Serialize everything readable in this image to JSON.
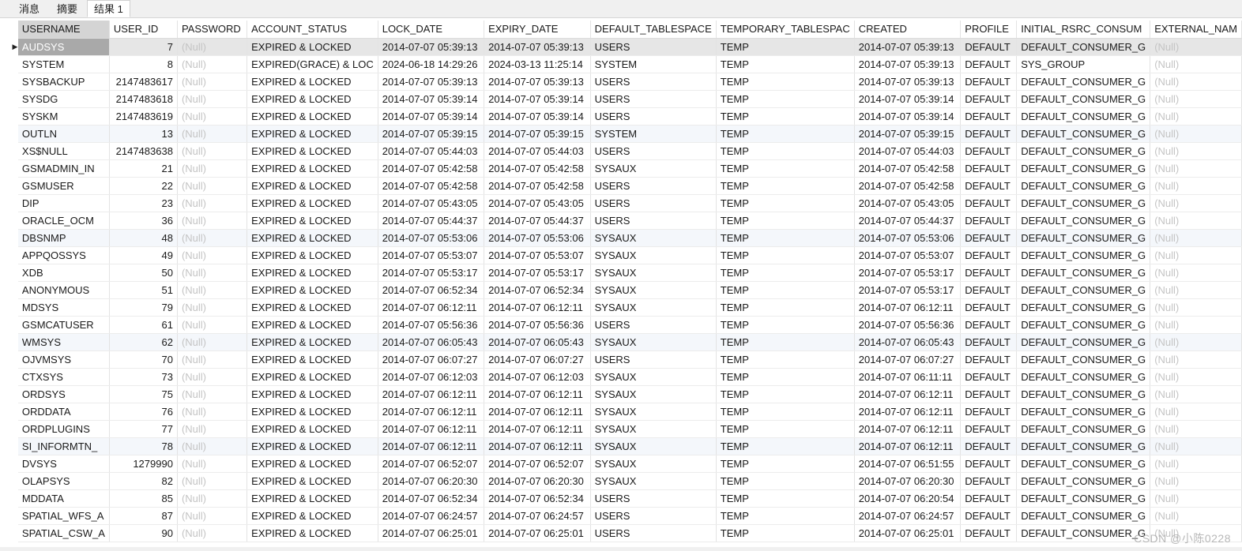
{
  "tabs": [
    "消息",
    "摘要",
    "结果 1"
  ],
  "active_tab": 2,
  "columns": [
    "USERNAME",
    "USER_ID",
    "PASSWORD",
    "ACCOUNT_STATUS",
    "LOCK_DATE",
    "EXPIRY_DATE",
    "DEFAULT_TABLESPACE",
    "TEMPORARY_TABLESPAC",
    "CREATED",
    "PROFILE",
    "INITIAL_RSRC_CONSUM",
    "EXTERNAL_NAM"
  ],
  "null_text": "(Null)",
  "current_row_marker": "▶",
  "rows": [
    [
      "AUDSYS",
      "7",
      "(Null)",
      "EXPIRED & LOCKED",
      "2014-07-07 05:39:13",
      "2014-07-07 05:39:13",
      "USERS",
      "TEMP",
      "2014-07-07 05:39:13",
      "DEFAULT",
      "DEFAULT_CONSUMER_G",
      "(Null)"
    ],
    [
      "SYSTEM",
      "8",
      "(Null)",
      "EXPIRED(GRACE) & LOC",
      "2024-06-18 14:29:26",
      "2024-03-13 11:25:14",
      "SYSTEM",
      "TEMP",
      "2014-07-07 05:39:13",
      "DEFAULT",
      "SYS_GROUP",
      "(Null)"
    ],
    [
      "SYSBACKUP",
      "2147483617",
      "(Null)",
      "EXPIRED & LOCKED",
      "2014-07-07 05:39:13",
      "2014-07-07 05:39:13",
      "USERS",
      "TEMP",
      "2014-07-07 05:39:13",
      "DEFAULT",
      "DEFAULT_CONSUMER_G",
      "(Null)"
    ],
    [
      "SYSDG",
      "2147483618",
      "(Null)",
      "EXPIRED & LOCKED",
      "2014-07-07 05:39:14",
      "2014-07-07 05:39:14",
      "USERS",
      "TEMP",
      "2014-07-07 05:39:14",
      "DEFAULT",
      "DEFAULT_CONSUMER_G",
      "(Null)"
    ],
    [
      "SYSKM",
      "2147483619",
      "(Null)",
      "EXPIRED & LOCKED",
      "2014-07-07 05:39:14",
      "2014-07-07 05:39:14",
      "USERS",
      "TEMP",
      "2014-07-07 05:39:14",
      "DEFAULT",
      "DEFAULT_CONSUMER_G",
      "(Null)"
    ],
    [
      "OUTLN",
      "13",
      "(Null)",
      "EXPIRED & LOCKED",
      "2014-07-07 05:39:15",
      "2014-07-07 05:39:15",
      "SYSTEM",
      "TEMP",
      "2014-07-07 05:39:15",
      "DEFAULT",
      "DEFAULT_CONSUMER_G",
      "(Null)"
    ],
    [
      "XS$NULL",
      "2147483638",
      "(Null)",
      "EXPIRED & LOCKED",
      "2014-07-07 05:44:03",
      "2014-07-07 05:44:03",
      "USERS",
      "TEMP",
      "2014-07-07 05:44:03",
      "DEFAULT",
      "DEFAULT_CONSUMER_G",
      "(Null)"
    ],
    [
      "GSMADMIN_IN",
      "21",
      "(Null)",
      "EXPIRED & LOCKED",
      "2014-07-07 05:42:58",
      "2014-07-07 05:42:58",
      "SYSAUX",
      "TEMP",
      "2014-07-07 05:42:58",
      "DEFAULT",
      "DEFAULT_CONSUMER_G",
      "(Null)"
    ],
    [
      "GSMUSER",
      "22",
      "(Null)",
      "EXPIRED & LOCKED",
      "2014-07-07 05:42:58",
      "2014-07-07 05:42:58",
      "USERS",
      "TEMP",
      "2014-07-07 05:42:58",
      "DEFAULT",
      "DEFAULT_CONSUMER_G",
      "(Null)"
    ],
    [
      "DIP",
      "23",
      "(Null)",
      "EXPIRED & LOCKED",
      "2014-07-07 05:43:05",
      "2014-07-07 05:43:05",
      "USERS",
      "TEMP",
      "2014-07-07 05:43:05",
      "DEFAULT",
      "DEFAULT_CONSUMER_G",
      "(Null)"
    ],
    [
      "ORACLE_OCM",
      "36",
      "(Null)",
      "EXPIRED & LOCKED",
      "2014-07-07 05:44:37",
      "2014-07-07 05:44:37",
      "USERS",
      "TEMP",
      "2014-07-07 05:44:37",
      "DEFAULT",
      "DEFAULT_CONSUMER_G",
      "(Null)"
    ],
    [
      "DBSNMP",
      "48",
      "(Null)",
      "EXPIRED & LOCKED",
      "2014-07-07 05:53:06",
      "2014-07-07 05:53:06",
      "SYSAUX",
      "TEMP",
      "2014-07-07 05:53:06",
      "DEFAULT",
      "DEFAULT_CONSUMER_G",
      "(Null)"
    ],
    [
      "APPQOSSYS",
      "49",
      "(Null)",
      "EXPIRED & LOCKED",
      "2014-07-07 05:53:07",
      "2014-07-07 05:53:07",
      "SYSAUX",
      "TEMP",
      "2014-07-07 05:53:07",
      "DEFAULT",
      "DEFAULT_CONSUMER_G",
      "(Null)"
    ],
    [
      "XDB",
      "50",
      "(Null)",
      "EXPIRED & LOCKED",
      "2014-07-07 05:53:17",
      "2014-07-07 05:53:17",
      "SYSAUX",
      "TEMP",
      "2014-07-07 05:53:17",
      "DEFAULT",
      "DEFAULT_CONSUMER_G",
      "(Null)"
    ],
    [
      "ANONYMOUS",
      "51",
      "(Null)",
      "EXPIRED & LOCKED",
      "2014-07-07 06:52:34",
      "2014-07-07 06:52:34",
      "SYSAUX",
      "TEMP",
      "2014-07-07 05:53:17",
      "DEFAULT",
      "DEFAULT_CONSUMER_G",
      "(Null)"
    ],
    [
      "MDSYS",
      "79",
      "(Null)",
      "EXPIRED & LOCKED",
      "2014-07-07 06:12:11",
      "2014-07-07 06:12:11",
      "SYSAUX",
      "TEMP",
      "2014-07-07 06:12:11",
      "DEFAULT",
      "DEFAULT_CONSUMER_G",
      "(Null)"
    ],
    [
      "GSMCATUSER",
      "61",
      "(Null)",
      "EXPIRED & LOCKED",
      "2014-07-07 05:56:36",
      "2014-07-07 05:56:36",
      "USERS",
      "TEMP",
      "2014-07-07 05:56:36",
      "DEFAULT",
      "DEFAULT_CONSUMER_G",
      "(Null)"
    ],
    [
      "WMSYS",
      "62",
      "(Null)",
      "EXPIRED & LOCKED",
      "2014-07-07 06:05:43",
      "2014-07-07 06:05:43",
      "SYSAUX",
      "TEMP",
      "2014-07-07 06:05:43",
      "DEFAULT",
      "DEFAULT_CONSUMER_G",
      "(Null)"
    ],
    [
      "OJVMSYS",
      "70",
      "(Null)",
      "EXPIRED & LOCKED",
      "2014-07-07 06:07:27",
      "2014-07-07 06:07:27",
      "USERS",
      "TEMP",
      "2014-07-07 06:07:27",
      "DEFAULT",
      "DEFAULT_CONSUMER_G",
      "(Null)"
    ],
    [
      "CTXSYS",
      "73",
      "(Null)",
      "EXPIRED & LOCKED",
      "2014-07-07 06:12:03",
      "2014-07-07 06:12:03",
      "SYSAUX",
      "TEMP",
      "2014-07-07 06:11:11",
      "DEFAULT",
      "DEFAULT_CONSUMER_G",
      "(Null)"
    ],
    [
      "ORDSYS",
      "75",
      "(Null)",
      "EXPIRED & LOCKED",
      "2014-07-07 06:12:11",
      "2014-07-07 06:12:11",
      "SYSAUX",
      "TEMP",
      "2014-07-07 06:12:11",
      "DEFAULT",
      "DEFAULT_CONSUMER_G",
      "(Null)"
    ],
    [
      "ORDDATA",
      "76",
      "(Null)",
      "EXPIRED & LOCKED",
      "2014-07-07 06:12:11",
      "2014-07-07 06:12:11",
      "SYSAUX",
      "TEMP",
      "2014-07-07 06:12:11",
      "DEFAULT",
      "DEFAULT_CONSUMER_G",
      "(Null)"
    ],
    [
      "ORDPLUGINS",
      "77",
      "(Null)",
      "EXPIRED & LOCKED",
      "2014-07-07 06:12:11",
      "2014-07-07 06:12:11",
      "SYSAUX",
      "TEMP",
      "2014-07-07 06:12:11",
      "DEFAULT",
      "DEFAULT_CONSUMER_G",
      "(Null)"
    ],
    [
      "SI_INFORMTN_",
      "78",
      "(Null)",
      "EXPIRED & LOCKED",
      "2014-07-07 06:12:11",
      "2014-07-07 06:12:11",
      "SYSAUX",
      "TEMP",
      "2014-07-07 06:12:11",
      "DEFAULT",
      "DEFAULT_CONSUMER_G",
      "(Null)"
    ],
    [
      "DVSYS",
      "1279990",
      "(Null)",
      "EXPIRED & LOCKED",
      "2014-07-07 06:52:07",
      "2014-07-07 06:52:07",
      "SYSAUX",
      "TEMP",
      "2014-07-07 06:51:55",
      "DEFAULT",
      "DEFAULT_CONSUMER_G",
      "(Null)"
    ],
    [
      "OLAPSYS",
      "82",
      "(Null)",
      "EXPIRED & LOCKED",
      "2014-07-07 06:20:30",
      "2014-07-07 06:20:30",
      "SYSAUX",
      "TEMP",
      "2014-07-07 06:20:30",
      "DEFAULT",
      "DEFAULT_CONSUMER_G",
      "(Null)"
    ],
    [
      "MDDATA",
      "85",
      "(Null)",
      "EXPIRED & LOCKED",
      "2014-07-07 06:52:34",
      "2014-07-07 06:52:34",
      "USERS",
      "TEMP",
      "2014-07-07 06:20:54",
      "DEFAULT",
      "DEFAULT_CONSUMER_G",
      "(Null)"
    ],
    [
      "SPATIAL_WFS_A",
      "87",
      "(Null)",
      "EXPIRED & LOCKED",
      "2014-07-07 06:24:57",
      "2014-07-07 06:24:57",
      "USERS",
      "TEMP",
      "2014-07-07 06:24:57",
      "DEFAULT",
      "DEFAULT_CONSUMER_G",
      "(Null)"
    ],
    [
      "SPATIAL_CSW_A",
      "90",
      "(Null)",
      "EXPIRED & LOCKED",
      "2014-07-07 06:25:01",
      "2014-07-07 06:25:01",
      "USERS",
      "TEMP",
      "2014-07-07 06:25:01",
      "DEFAULT",
      "DEFAULT_CONSUMER_G",
      "(Null)"
    ]
  ],
  "watermark": "CSDN @小陈0228"
}
